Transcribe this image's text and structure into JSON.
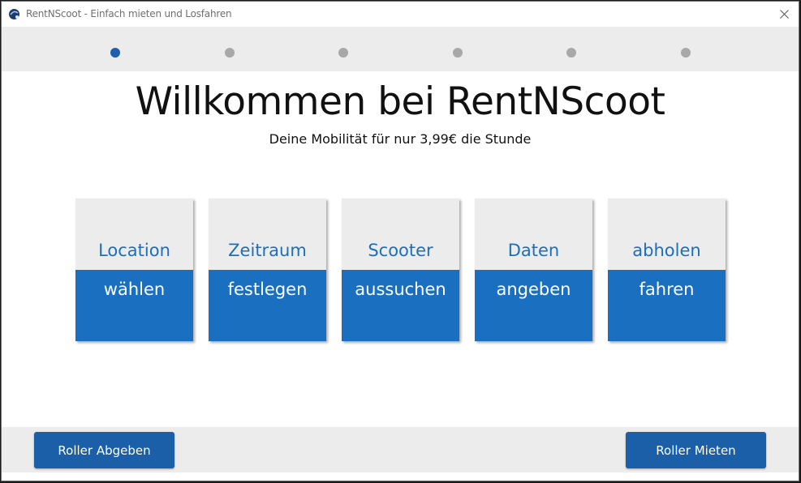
{
  "window": {
    "title": "RentNScoot - Einfach mieten und Losfahren",
    "close_icon": "close-icon"
  },
  "steps": {
    "count": 6,
    "active_index": 0,
    "active_color": "#1f5fae",
    "inactive_color": "#a8a8a8"
  },
  "main": {
    "headline": "Willkommen bei RentNScoot",
    "subline": "Deine Mobilität für nur 3,99€ die Stunde"
  },
  "tiles": [
    {
      "top": "Location",
      "bottom": "wählen"
    },
    {
      "top": "Zeitraum",
      "bottom": "festlegen"
    },
    {
      "top": "Scooter",
      "bottom": "aussuchen"
    },
    {
      "top": "Daten",
      "bottom": "angeben"
    },
    {
      "top": "abholen",
      "bottom": "fahren"
    }
  ],
  "footer": {
    "return_button": "Roller Abgeben",
    "rent_button": "Roller Mieten"
  },
  "colors": {
    "accent": "#1a6fc0",
    "button": "#1a5fa8",
    "panel": "#ececec"
  }
}
